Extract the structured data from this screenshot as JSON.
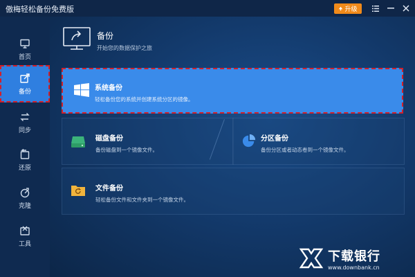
{
  "app": {
    "title": "傲梅轻松备份免费版"
  },
  "titlebar": {
    "upgrade_label": "升级",
    "upgrade_icon": "up-arrow-icon",
    "menu_icon": "menu-icon",
    "minimize_icon": "minimize-icon",
    "close_icon": "close-icon"
  },
  "sidebar": {
    "items": [
      {
        "label": "首页",
        "icon": "monitor-icon",
        "active": false
      },
      {
        "label": "备份",
        "icon": "backup-icon",
        "active": true
      },
      {
        "label": "同步",
        "icon": "sync-icon",
        "active": false
      },
      {
        "label": "还原",
        "icon": "restore-icon",
        "active": false
      },
      {
        "label": "克隆",
        "icon": "clone-icon",
        "active": false
      },
      {
        "label": "工具",
        "icon": "tools-icon",
        "active": false
      }
    ]
  },
  "header": {
    "title": "备份",
    "subtitle": "开始您的数据保护之旅"
  },
  "cards": {
    "system": {
      "title": "系统备份",
      "desc": "轻松备份您的系统并创建系统分区的镜像。"
    },
    "disk": {
      "title": "磁盘备份",
      "desc": "备份磁盘到一个镜像文件。"
    },
    "partition": {
      "title": "分区备份",
      "desc": "备份分区或者动态卷到一个镜像文件。"
    },
    "file": {
      "title": "文件备份",
      "desc": "轻松备份文件和文件夹到一个镜像文件。"
    }
  },
  "watermark": {
    "name": "下载银行",
    "url": "www.downbank.cn"
  },
  "colors": {
    "accent": "#3a8bea",
    "highlight_border": "#d2202a",
    "upgrade": "#f08a1a",
    "sidebar_bg": "#0f2a50"
  }
}
